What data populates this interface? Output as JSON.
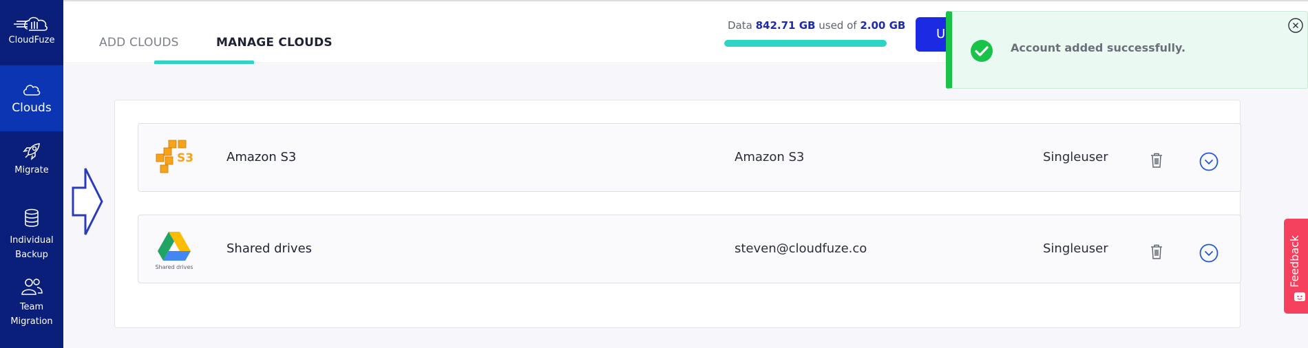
{
  "sidebar": {
    "brand": "CloudFuze",
    "items": [
      {
        "label": "Clouds",
        "icon": "cloud-icon"
      },
      {
        "label": "Migrate",
        "icon": "rocket-icon"
      },
      {
        "label_line1": "Individual",
        "label_line2": "Backup",
        "icon": "database-icon"
      },
      {
        "label_line1": "Team",
        "label_line2": "Migration",
        "icon": "users-icon"
      }
    ]
  },
  "tabs": {
    "add": "ADD CLOUDS",
    "manage": "MANAGE CLOUDS"
  },
  "usage": {
    "prefix": "Data",
    "used": "842.71 GB",
    "middle": "used of",
    "total": "2.00 GB",
    "fill_percent": 100
  },
  "upgrade_button": "Up",
  "clouds": [
    {
      "name": "Amazon S3",
      "account": "Amazon S3",
      "type": "Singleuser",
      "logo_text": "S3"
    },
    {
      "name": "Shared drives",
      "account": "steven@cloudfuze.co",
      "type": "Singleuser",
      "logo_text": "Shared drives"
    }
  ],
  "toast": {
    "message": "Account added successfully."
  },
  "feedback": "Feedback",
  "colors": {
    "sidebar": "#0a1f7a",
    "sidebar_active": "#0b35b3",
    "accent_teal": "#2ed3c7",
    "primary_button": "#1b2be3",
    "toast_green": "#19c34a",
    "feedback_red": "#f5405e"
  }
}
